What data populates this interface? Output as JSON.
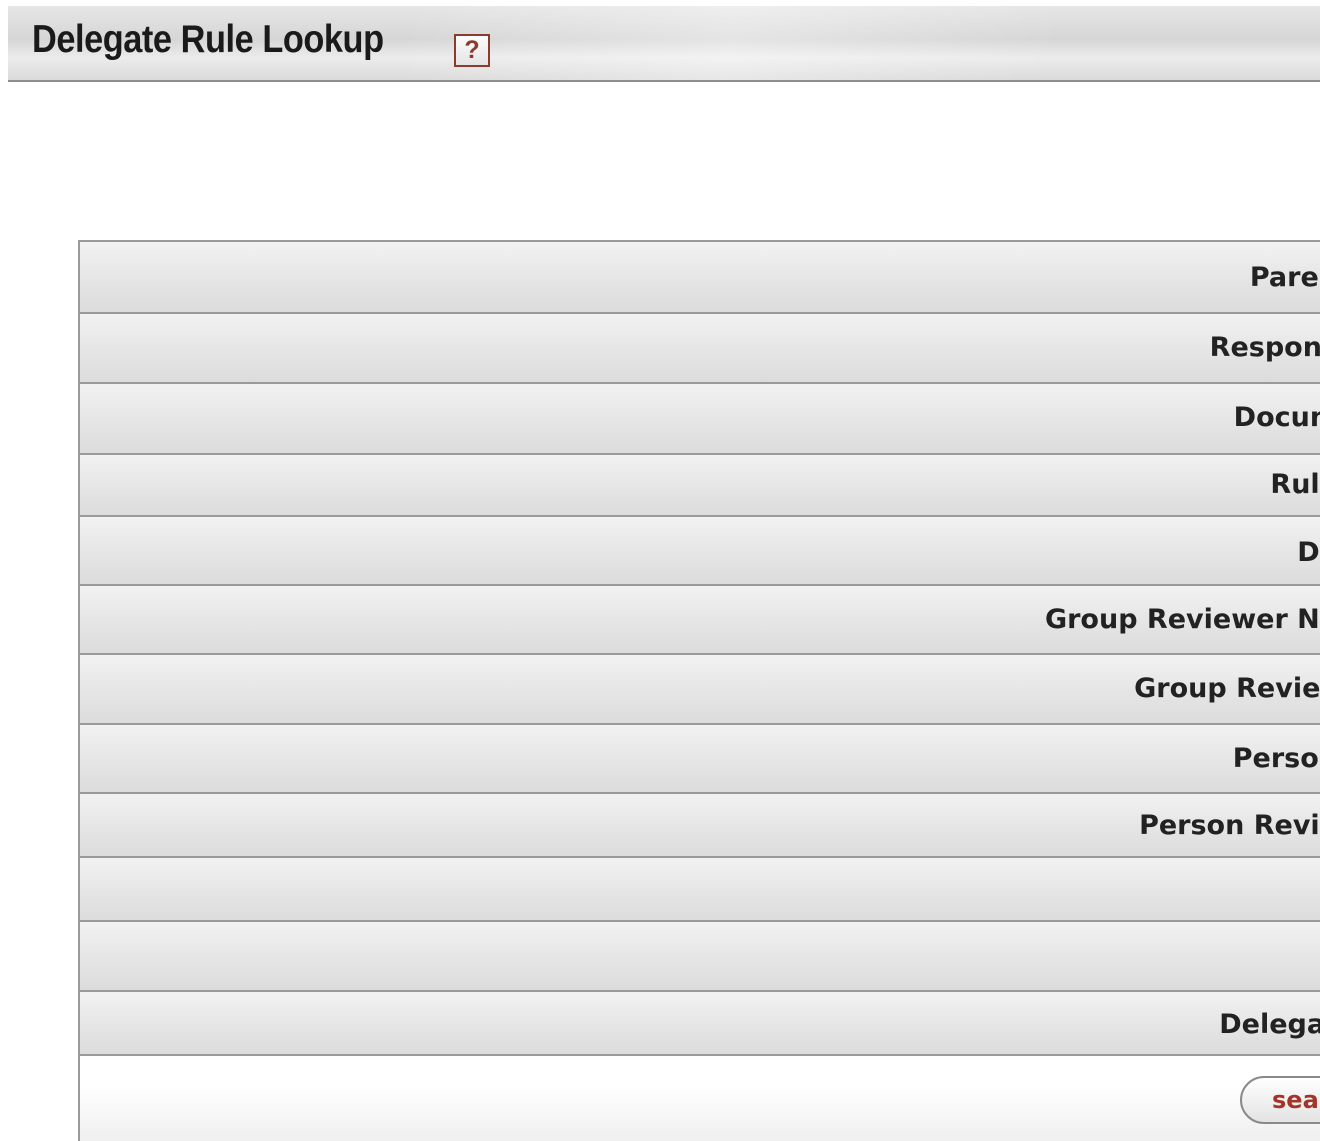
{
  "header": {
    "title": "Delegate Rule Lookup",
    "help_icon": "?"
  },
  "form": {
    "rows": [
      {
        "label": "Paren"
      },
      {
        "label": "Respons"
      },
      {
        "label": "Docum"
      },
      {
        "label": "Rule "
      },
      {
        "label": "De"
      },
      {
        "label": "Group Reviewer Na"
      },
      {
        "label": "Group Reviev"
      },
      {
        "label": "Person "
      },
      {
        "label": "Person Revie"
      },
      {
        "label": ""
      },
      {
        "label": ""
      },
      {
        "label": "Delegat"
      }
    ]
  },
  "actions": {
    "search_label": "sea"
  },
  "colors": {
    "accent": "#a3342a",
    "border": "#9a9a9a",
    "row_background": "#e5e5e5"
  }
}
